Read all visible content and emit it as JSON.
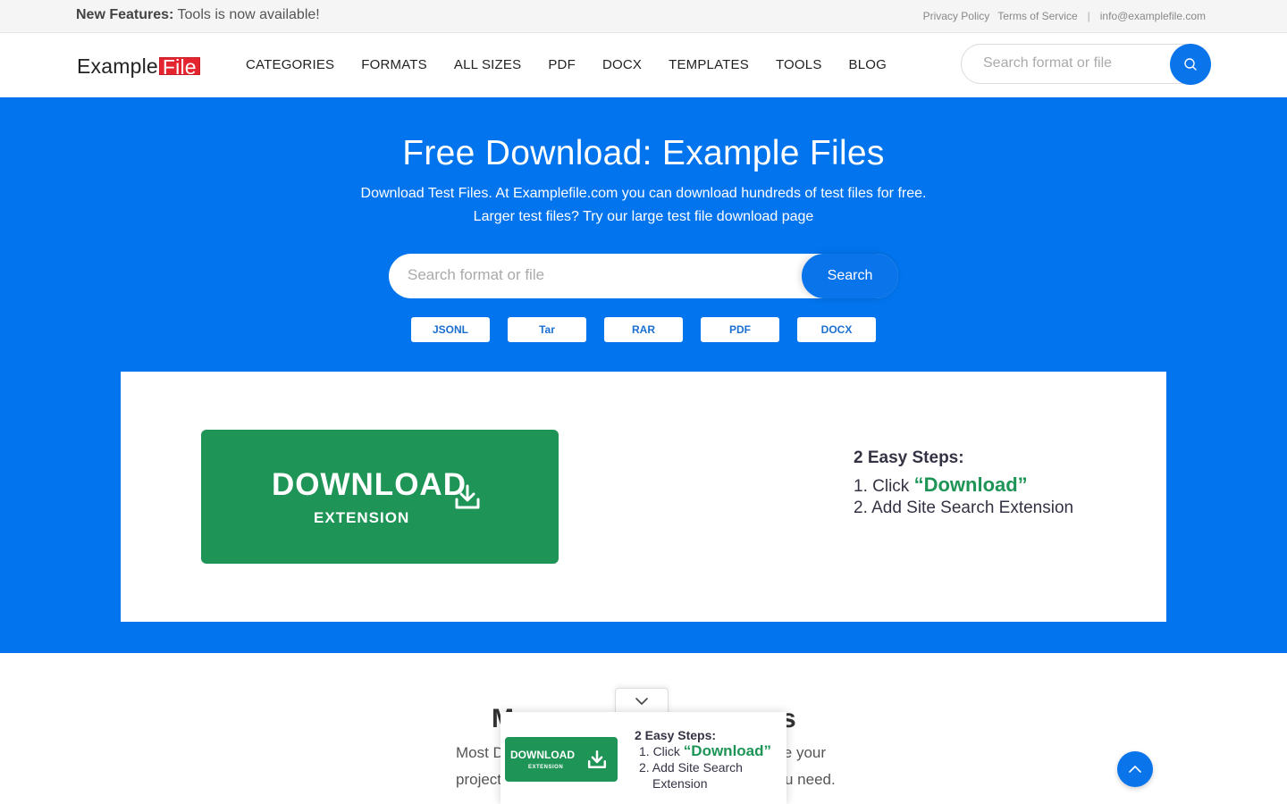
{
  "topbar": {
    "announce_bold": "New Features:",
    "announce_text": " Tools is now available!",
    "privacy": "Privacy Policy",
    "terms": "Terms of Service",
    "separator": "|",
    "email": "info@examplefile.com"
  },
  "nav": {
    "logo_part1": "Example",
    "logo_part2": "File",
    "menu": [
      "CATEGORIES",
      "FORMATS",
      "ALL SIZES",
      "PDF",
      "DOCX",
      "TEMPLATES",
      "TOOLS",
      "BLOG"
    ],
    "search_placeholder": "Search format or file",
    "search_icon": "search-icon"
  },
  "hero": {
    "title": "Free Download: Example Files",
    "sub1": "Download Test Files. At Examplefile.com you can download hundreds of test files for free.",
    "sub2": "Larger test files? Try our large test file download page",
    "search_placeholder": "Search format or file",
    "search_button": "Search",
    "chips": [
      "JSONL",
      "Tar",
      "RAR",
      "PDF",
      "DOCX"
    ]
  },
  "promo": {
    "download_label": "DOWNLOAD",
    "extension_label": "EXTENSION",
    "steps_head": "2 Easy Steps:",
    "step1_prefix": "1. Click ",
    "step1_highlight": "“Download”",
    "step2": "2. Add Site Search Extension"
  },
  "lower": {
    "title_left": "M",
    "title_right": "s",
    "text1_left": "Most D",
    "text1_right": "le your",
    "text2_left": "project",
    "text2_right": "u need."
  },
  "popup": {
    "download_label": "DOWNLOAD",
    "extension_label": "EXTENSION",
    "steps_head": "2 Easy Steps:",
    "step1_prefix": "1. Click ",
    "step1_highlight": "“Download”",
    "step2_line1": "2. Add Site Search",
    "step2_line2": "Extension"
  },
  "colors": {
    "primary_blue": "#0274ed",
    "download_green": "#1e9556",
    "logo_red": "#e4252f"
  }
}
